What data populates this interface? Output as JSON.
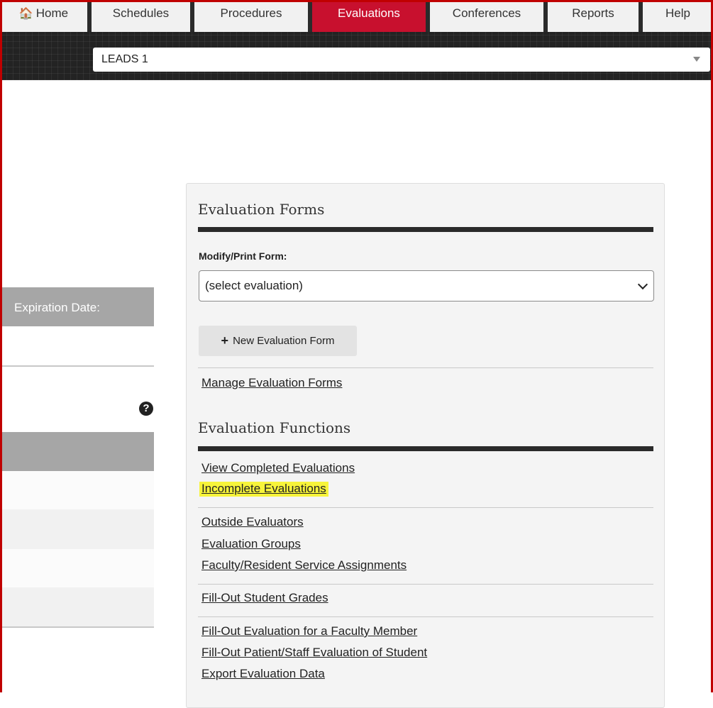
{
  "nav": {
    "tabs": [
      {
        "label": "Home",
        "icon": "home-icon"
      },
      {
        "label": "Schedules"
      },
      {
        "label": "Procedures"
      },
      {
        "label": "Evaluations",
        "active": true
      },
      {
        "label": "Conferences"
      },
      {
        "label": "Reports"
      },
      {
        "label": "Help"
      }
    ]
  },
  "program_select": {
    "value": "LEADS 1"
  },
  "left_panel": {
    "expiration_label": "Expiration Date:"
  },
  "forms_section": {
    "title": "Evaluation Forms",
    "modify_label": "Modify/Print Form:",
    "select_value": "(select evaluation)",
    "new_button": "New Evaluation Form",
    "manage_link": "Manage Evaluation Forms"
  },
  "functions_section": {
    "title": "Evaluation Functions",
    "groups": [
      [
        "View Completed Evaluations",
        "Incomplete Evaluations"
      ],
      [
        "Outside Evaluators",
        "Evaluation Groups",
        "Faculty/Resident Service Assignments"
      ],
      [
        "Fill-Out Student Grades"
      ],
      [
        "Fill-Out Evaluation for a Faculty Member",
        "Fill-Out Patient/Staff Evaluation of Student",
        "Export Evaluation Data"
      ]
    ]
  },
  "colors": {
    "accent": "#c8102e",
    "highlight": "#f7f43a"
  }
}
